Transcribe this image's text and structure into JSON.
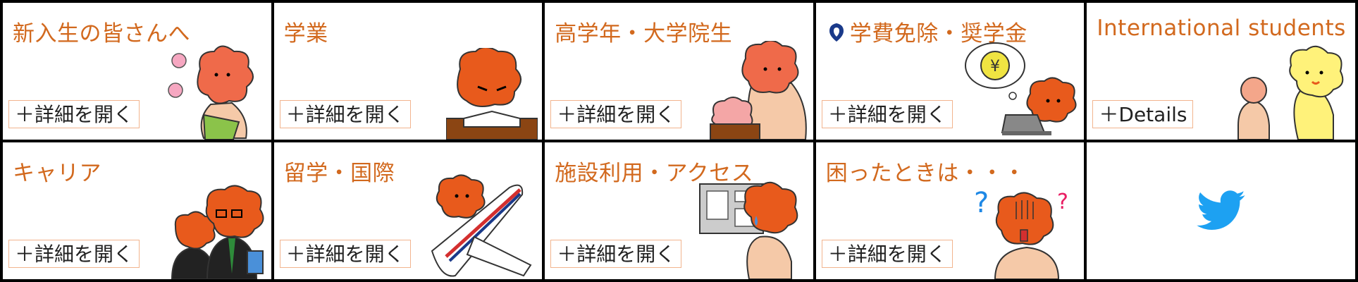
{
  "tiles": [
    {
      "title": "新入生の皆さんへ",
      "button": "＋詳細を開く"
    },
    {
      "title": "学業",
      "button": "＋詳細を開く"
    },
    {
      "title": "高学年・大学院生",
      "button": "＋詳細を開く"
    },
    {
      "title": "学費免除・奨学金",
      "button": "＋詳細を開く"
    },
    {
      "title": "International students",
      "button": "＋Details"
    },
    {
      "title": "キャリア",
      "button": "＋詳細を開く"
    },
    {
      "title": "留学・国際",
      "button": "＋詳細を開く"
    },
    {
      "title": "施設利用・アクセス",
      "button": "＋詳細を開く"
    },
    {
      "title": "困ったときは・・・",
      "button": "＋詳細を開く"
    }
  ],
  "colors": {
    "title": "#d2691e",
    "button_border": "#f2b48e",
    "twitter": "#1da1f2",
    "mascot": "#e85a1c"
  },
  "icons": [
    "mascot-illustration",
    "twitter-icon"
  ]
}
